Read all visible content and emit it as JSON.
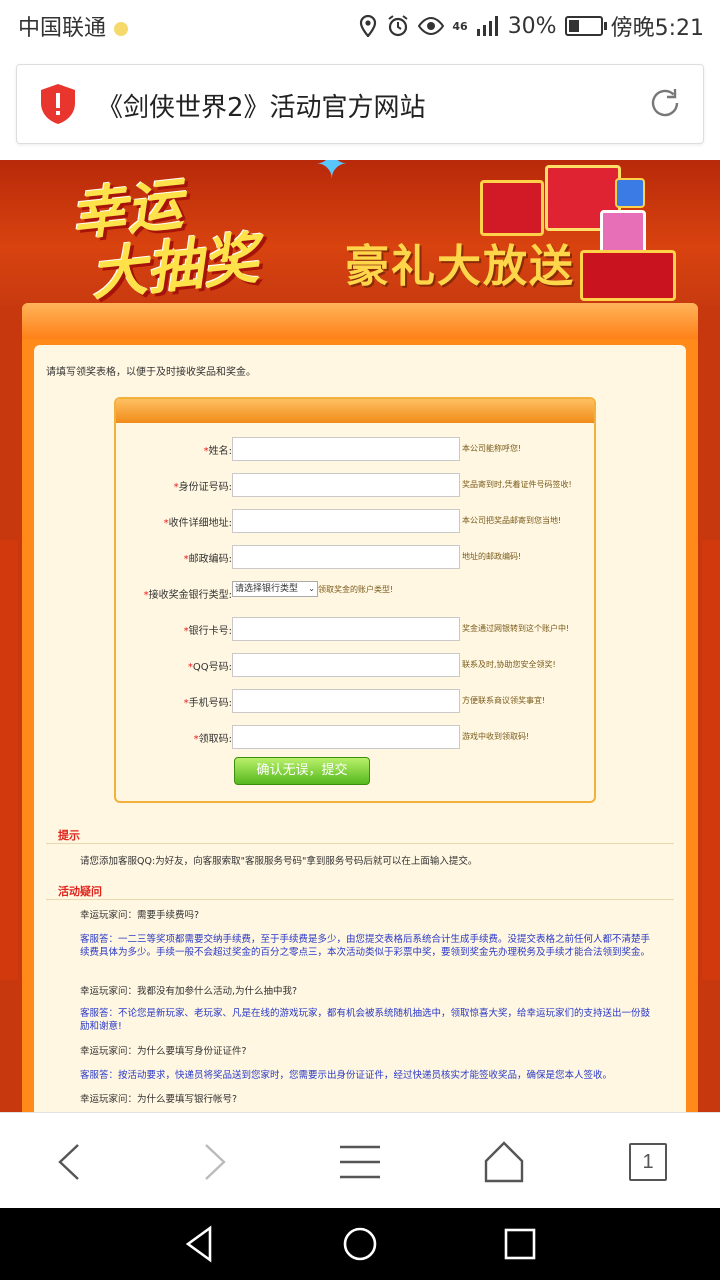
{
  "status_bar": {
    "carrier": "中国联通",
    "signal": "46",
    "battery": "30%",
    "time": "傍晚5:21"
  },
  "browser": {
    "page_title": "《剑侠世界2》活动官方网站",
    "tab_count": "1"
  },
  "banner": {
    "line1": "幸运",
    "line2": "大抽奖",
    "slogan": "豪礼大放送"
  },
  "page": {
    "intro": "请填写领奖表格，以便于及时接收奖品和奖金。",
    "form": {
      "fields": [
        {
          "label": "姓名:",
          "hint": "本公司能称呼您!"
        },
        {
          "label": "身份证号码:",
          "hint": "奖品寄到时,凭着证件号码签收!"
        },
        {
          "label": "收件详细地址:",
          "hint": "本公司把奖品邮寄到您当地!"
        },
        {
          "label": "邮政编码:",
          "hint": "地址的邮政编码!"
        },
        {
          "label": "接收奖金银行类型:",
          "hint": "领取奖金的账户类型!",
          "select": "请选择银行类型"
        },
        {
          "label": "银行卡号:",
          "hint": "奖金通过网银转到这个账户中!"
        },
        {
          "label": "QQ号码:",
          "hint": "联系及时,协助您安全领奖!"
        },
        {
          "label": "手机号码:",
          "hint": "方便联系商议领奖事宜!"
        },
        {
          "label": "领取码:",
          "hint": "游戏中收到领取码!"
        }
      ],
      "required_mark": "*",
      "submit_label": "确认无误，提交"
    },
    "tip_title": "提示",
    "tip_text": "请您添加客服QQ:为好友，向客服索取\"客服服务号码\"拿到服务号码后就可以在上面输入提交。",
    "faq_title": "活动疑问",
    "faq": [
      {
        "q": "幸运玩家问：需要手续费吗?",
        "a": "客服答：一二三等奖项都需要交纳手续费，至于手续费是多少，由您提交表格后系统合计生成手续费。没提交表格之前任何人都不清楚手续费具体为多少。手续一般不会超过奖金的百分之零点三，本次活动类似于彩票中奖，要领到奖金先办理税务及手续才能合法领到奖金。"
      },
      {
        "q": "幸运玩家问：我都没有加参什么活动,为什么抽中我?",
        "a": "客服答：不论您是新玩家、老玩家、凡是在线的游戏玩家，都有机会被系统随机抽选中，领取惊喜大奖，给幸运玩家们的支持送出一份鼓励和谢意!"
      },
      {
        "q": "幸运玩家问：为什么要填写身份证证件?",
        "a": "客服答：按活动要求，快递员将奖品送到您家时，您需要示出身份证证件，经过快递员核实才能签收奖品，确保是您本人签收。"
      },
      {
        "q": "幸运玩家问：为什么要填写银行帐号?",
        "a": ""
      }
    ]
  },
  "colors": {
    "accent_orange": "#ff8a1a",
    "banner_red": "#c7380f",
    "required_red": "#e31b1b",
    "answer_blue": "#2a39c8",
    "submit_green": "#56b81e"
  }
}
